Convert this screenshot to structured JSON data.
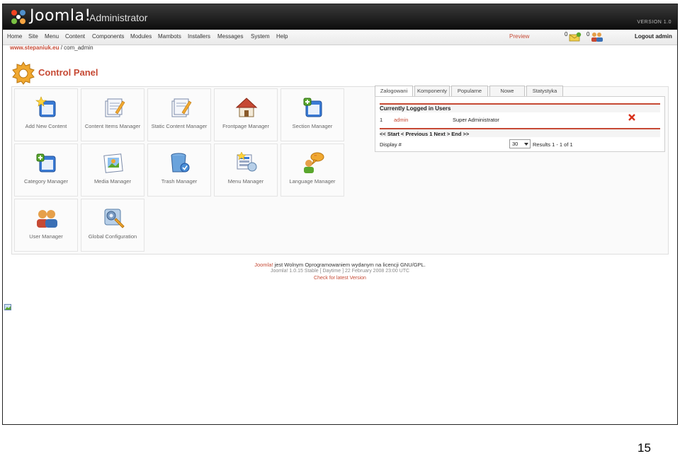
{
  "header": {
    "brand": "Joomla!",
    "subtitle": "Administrator",
    "version": "VERSION 1.0"
  },
  "menu": {
    "items": [
      "Home",
      "Site",
      "Menu",
      "Content",
      "Components",
      "Modules",
      "Mambots",
      "Installers",
      "Messages",
      "System",
      "Help"
    ],
    "preview": "Preview",
    "messages_count": "0",
    "users_count": "0",
    "logout": "Logout admin"
  },
  "path": {
    "site": "www.stepaniuk.eu",
    "separator": " / ",
    "component": "com_admin"
  },
  "page": {
    "title": "Control Panel"
  },
  "tiles": [
    {
      "label": "Add New Content",
      "icon": "add-content-icon"
    },
    {
      "label": "Content Items Manager",
      "icon": "content-items-icon"
    },
    {
      "label": "Static Content Manager",
      "icon": "static-content-icon"
    },
    {
      "label": "Frontpage Manager",
      "icon": "frontpage-icon"
    },
    {
      "label": "Section Manager",
      "icon": "section-icon"
    },
    {
      "label": "Category Manager",
      "icon": "category-icon"
    },
    {
      "label": "Media Manager",
      "icon": "media-icon"
    },
    {
      "label": "Trash Manager",
      "icon": "trash-icon"
    },
    {
      "label": "Menu Manager",
      "icon": "menu-manager-icon"
    },
    {
      "label": "Language Manager",
      "icon": "language-icon"
    },
    {
      "label": "User Manager",
      "icon": "users-icon"
    },
    {
      "label": "Global Configuration",
      "icon": "config-icon"
    }
  ],
  "tabs": {
    "items": [
      "Zalogowani",
      "Komponenty",
      "Popularne",
      "Nowe",
      "Statystyka"
    ],
    "active": "Zalogowani",
    "heading": "Currently Logged in Users",
    "rows": [
      {
        "num": "1",
        "user": "admin",
        "role": "Super Administrator"
      }
    ],
    "pager": "<< Start < Previous 1 Next > End >>",
    "display_label": "Display #",
    "display_value": "30",
    "results": "Results 1 - 1 of 1"
  },
  "footer": {
    "brand": "Joomla!",
    "license_text": " jest Wolnym Oprogramowaniem wydanym na licencji GNU/GPL.",
    "version_line": "Joomla! 1.0.15 Stable [ Daytime ] 22 February 2008 23:00 UTC",
    "check_link": "Check for latest Version"
  },
  "slide": {
    "page_number": "15"
  },
  "colors": {
    "accent": "#c64934",
    "header_bg": "#1b1b1b"
  }
}
